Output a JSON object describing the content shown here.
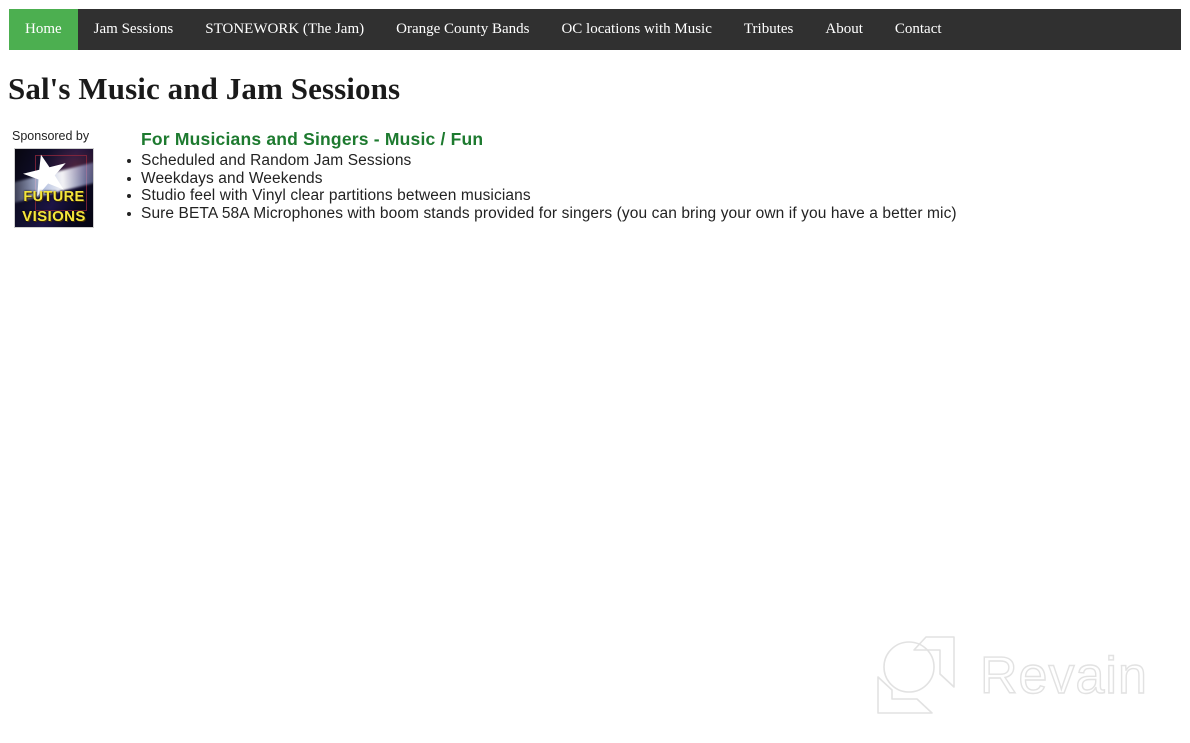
{
  "nav": {
    "items": [
      {
        "label": "Home",
        "active": true
      },
      {
        "label": "Jam Sessions",
        "active": false
      },
      {
        "label": "STONEWORK (The Jam)",
        "active": false
      },
      {
        "label": "Orange County Bands",
        "active": false
      },
      {
        "label": "OC locations with Music",
        "active": false
      },
      {
        "label": "Tributes",
        "active": false
      },
      {
        "label": "About",
        "active": false
      },
      {
        "label": "Contact",
        "active": false
      }
    ],
    "active_color": "#4caf50",
    "bar_color": "#303030",
    "text_color": "#ffffff"
  },
  "page": {
    "title": "Sal's Music and Jam Sessions",
    "background": "#ffffff"
  },
  "sponsor": {
    "label": "Sponsored by",
    "logo": {
      "name": "future-visions-logo",
      "line1": "FUTURE",
      "line2": "VISIONS",
      "text_color": "#f5e63c",
      "background_color": "#0b0b18"
    }
  },
  "main": {
    "heading": "For Musicians and Singers - Music / Fun",
    "heading_color": "#1d7a2f",
    "bullets": [
      "Scheduled and Random Jam Sessions",
      "Weekdays and Weekends",
      "Studio feel with Vinyl clear partitions between musicians",
      "Sure BETA 58A Microphones with boom stands provided for singers (you can bring your own if you have a better mic)"
    ]
  },
  "watermark": {
    "text": "Revain",
    "color": "#e2e2e2"
  }
}
